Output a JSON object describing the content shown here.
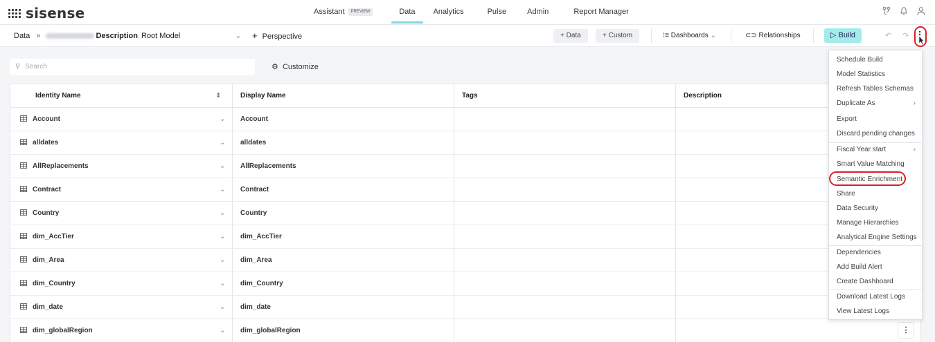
{
  "brand": {
    "name": "sisense"
  },
  "topnav": {
    "tabs": [
      {
        "label": "Assistant",
        "badge": "PREVIEW"
      },
      {
        "label": "Data"
      },
      {
        "label": "Analytics"
      },
      {
        "label": "Pulse"
      },
      {
        "label": "Admin"
      },
      {
        "label": "Report Manager"
      }
    ],
    "active_tab": "Data",
    "icons": [
      "git-branch-icon",
      "bell-icon",
      "user-icon"
    ]
  },
  "toolbar": {
    "breadcrumb_root": "Data",
    "breadcrumb_sep": "»",
    "model_name_suffix": "Description",
    "perspective_select": "Root Model",
    "add_perspective": "Perspective",
    "add_data": "Data",
    "add_custom": "Custom",
    "dashboards": "Dashboards",
    "relationships": "Relationships",
    "build": "Build"
  },
  "search": {
    "placeholder": "Search"
  },
  "customize_label": "Customize",
  "table": {
    "headers": [
      "Identity Name",
      "Display Name",
      "Tags",
      "Description"
    ],
    "rows": [
      {
        "identity": "Account",
        "display": "Account"
      },
      {
        "identity": "alldates",
        "display": "alldates"
      },
      {
        "identity": "AllReplacements",
        "display": "AllReplacements"
      },
      {
        "identity": "Contract",
        "display": "Contract"
      },
      {
        "identity": "Country",
        "display": "Country"
      },
      {
        "identity": "dim_AccTier",
        "display": "dim_AccTier"
      },
      {
        "identity": "dim_Area",
        "display": "dim_Area"
      },
      {
        "identity": "dim_Country",
        "display": "dim_Country"
      },
      {
        "identity": "dim_date",
        "display": "dim_date"
      },
      {
        "identity": "dim_globalRegion",
        "display": "dim_globalRegion"
      }
    ]
  },
  "menu": {
    "items": [
      {
        "label": "Schedule Build"
      },
      {
        "label": "Model Statistics"
      },
      {
        "label": "Refresh Tables Schemas"
      },
      {
        "label": "Duplicate As",
        "submenu": true
      },
      {
        "label": "Export"
      },
      {
        "label": "Discard pending changes"
      },
      {
        "label": "Fiscal Year start",
        "submenu": true
      },
      {
        "label": "Smart Value Matching"
      },
      {
        "label": "Semantic Enrichment",
        "highlighted": true
      },
      {
        "label": "Share"
      },
      {
        "label": "Data Security"
      },
      {
        "label": "Manage Hierarchies"
      },
      {
        "label": "Analytical Engine Settings"
      },
      {
        "label": "Dependencies"
      },
      {
        "label": "Add Build Alert"
      },
      {
        "label": "Create Dashboard"
      },
      {
        "label": "Download Latest Logs"
      },
      {
        "label": "View Latest Logs"
      }
    ]
  },
  "colors": {
    "accent": "#7fd7d9",
    "build_bg": "#a2ecec",
    "annotation": "#d81f26"
  }
}
